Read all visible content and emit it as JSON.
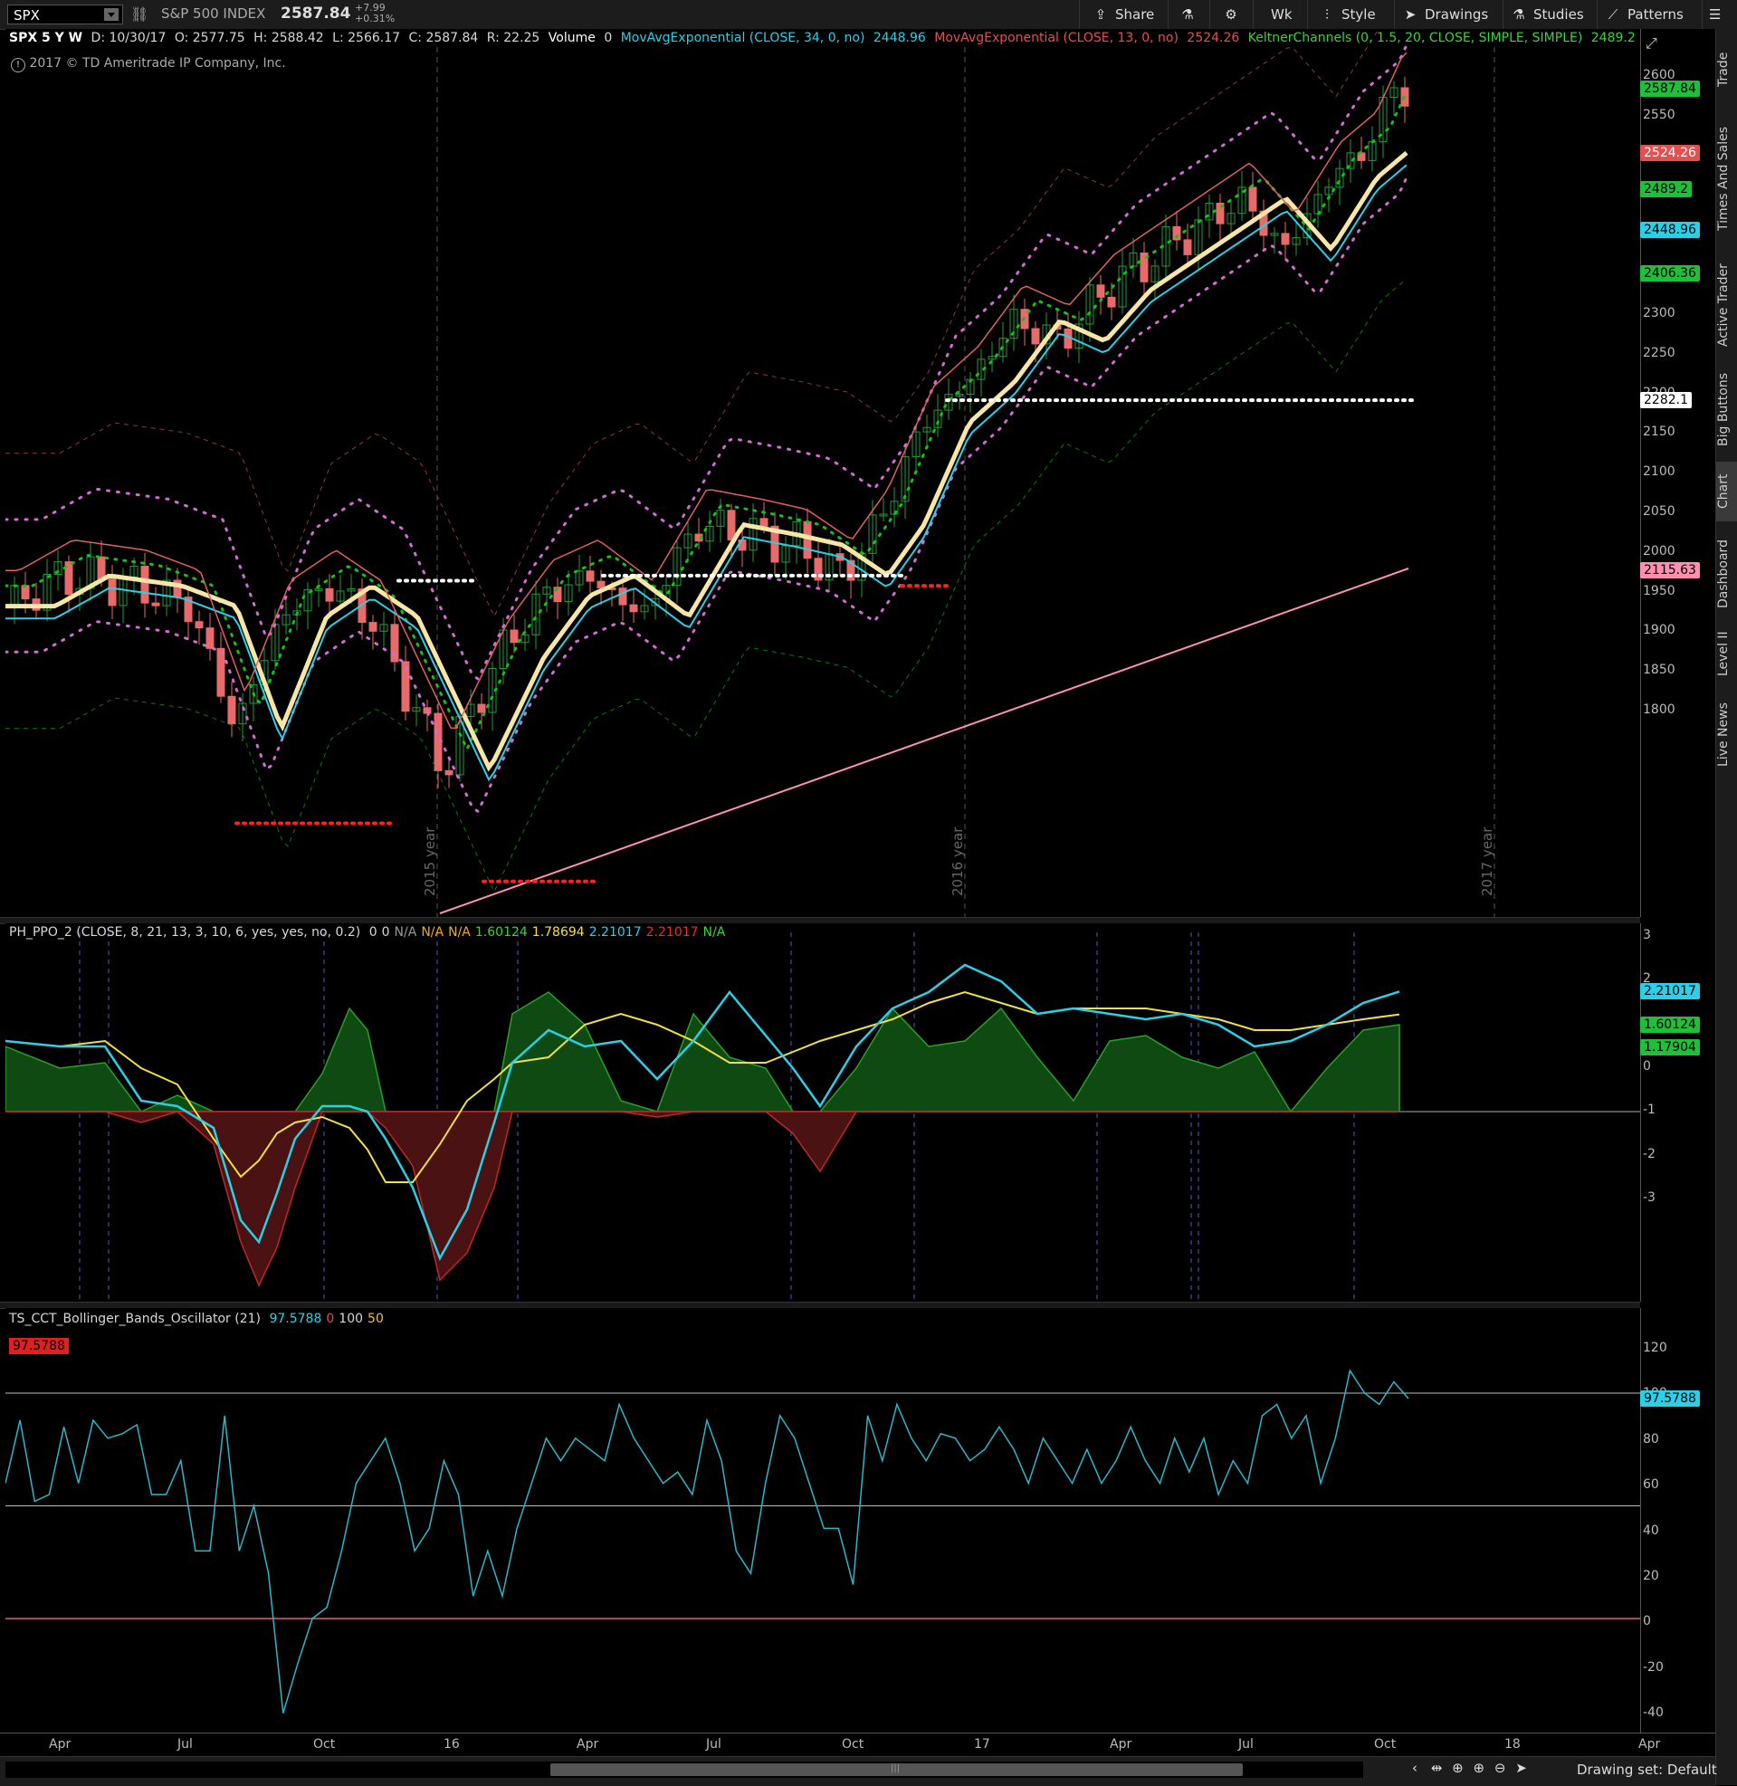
{
  "toolbar": {
    "symbol": "SPX",
    "description": "S&P 500 INDEX",
    "last": "2587.84",
    "change": "+7.99",
    "change_pct": "+0.31%",
    "share": "Share",
    "timeframe": "Wk",
    "style": "Style",
    "drawings": "Drawings",
    "studies": "Studies",
    "patterns": "Patterns"
  },
  "rail": [
    "Trade",
    "Times And Sales",
    "Active Trader",
    "Big Buttons",
    "Chart",
    "Dashboard",
    "Level II",
    "Live News"
  ],
  "price_panel": {
    "header": {
      "title": "SPX 5 Y W",
      "ohlc": [
        "D: 10/30/17",
        "O: 2577.75",
        "H: 2588.42",
        "L: 2566.17",
        "C: 2587.84",
        "R: 22.25"
      ],
      "volume_label": "Volume",
      "volume_val": "0",
      "ema34": "MovAvgExponential (CLOSE, 34, 0, no)",
      "ema34_val": "2448.96",
      "ema13": "MovAvgExponential (CLOSE, 13, 0, no)",
      "ema13_val": "2524.26",
      "keltner": "KeltnerChannels (0, 1.5, 20, CLOSE, SIMPLE, SIMPLE)",
      "keltner_val": "2489.2"
    },
    "copyright": "2017 © TD Ameritrade IP Company, Inc.",
    "ticks": [
      "2600",
      "2550",
      "2500",
      "2450",
      "2400",
      "2350",
      "2300",
      "2250",
      "2200",
      "2150",
      "2100",
      "2050",
      "2000",
      "1950",
      "1900",
      "1850",
      "1800"
    ],
    "tags": [
      {
        "v": "2587.84",
        "bg": "#1fbf3a",
        "fg": "#000"
      },
      {
        "v": "2524.26",
        "bg": "#e25050",
        "fg": "#fff"
      },
      {
        "v": "2489.2",
        "bg": "#1fbf3a",
        "fg": "#000"
      },
      {
        "v": "2448.96",
        "bg": "#2ad0e8",
        "fg": "#000"
      },
      {
        "v": "2406.36",
        "bg": "#1fbf3a",
        "fg": "#000"
      },
      {
        "v": "2282.1",
        "bg": "#ffffff",
        "fg": "#000"
      },
      {
        "v": "2115.63",
        "bg": "#ff8fb0",
        "fg": "#000"
      }
    ],
    "year_labels": [
      "2015 year",
      "2016 year",
      "2017 year"
    ]
  },
  "ppo_panel": {
    "header": {
      "name": "PH_PPO_2 (CLOSE, 8, 21, 13, 3, 10, 6, yes, yes, no, 0.2)",
      "vals": [
        {
          "v": "0",
          "c": "#d7d7d7"
        },
        {
          "v": "0",
          "c": "#d7d7d7"
        },
        {
          "v": "N/A",
          "c": "#999"
        },
        {
          "v": "N/A",
          "c": "#f5a623"
        },
        {
          "v": "N/A",
          "c": "#f5a623"
        },
        {
          "v": "1.60124",
          "c": "#3cd23c"
        },
        {
          "v": "1.78694",
          "c": "#f0e040"
        },
        {
          "v": "2.21017",
          "c": "#2ad0e8"
        },
        {
          "v": "2.21017",
          "c": "#e23030"
        },
        {
          "v": "N/A",
          "c": "#3cd23c"
        }
      ]
    },
    "ticks": [
      "3",
      "2",
      "1",
      "0",
      "-1",
      "-2",
      "-3"
    ],
    "tags": [
      {
        "v": "2.21017",
        "bg": "#2ad0e8",
        "fg": "#000"
      },
      {
        "v": "1.60124",
        "bg": "#1fbf3a",
        "fg": "#000"
      },
      {
        "v": "1.17904",
        "bg": "#1fbf3a",
        "fg": "#000"
      }
    ]
  },
  "osc_panel": {
    "header": {
      "name": "TS_CCT_Bollinger_Bands_Oscillator (21)",
      "vals": [
        {
          "v": "97.5788",
          "c": "#2ad0e8"
        },
        {
          "v": "0",
          "c": "#e25050"
        },
        {
          "v": "100",
          "c": "#d7d7d7"
        },
        {
          "v": "50",
          "c": "#f0c040"
        }
      ]
    },
    "corner_tag": "97.5788",
    "ticks": [
      "120",
      "100",
      "80",
      "60",
      "40",
      "20",
      "0",
      "-20",
      "-40"
    ],
    "tag": "97.5788"
  },
  "time_axis": [
    "Apr",
    "Jul",
    "Oct",
    "16",
    "Apr",
    "Jul",
    "Oct",
    "17",
    "Apr",
    "Jul",
    "Oct",
    "18",
    "Apr"
  ],
  "bottom": {
    "drawing_set": "Drawing set: Default"
  },
  "colors": {
    "bull": "#1f9e3a",
    "bear": "#e86a6a",
    "ema34": "#f7e6a6",
    "ema13": "#e06060",
    "keltner_mid": "#16c016",
    "keltner_band": "#d36bd3",
    "sma_long": "#ff8fb0",
    "ppo_fast": "#2ad0e8",
    "ppo_slow": "#f0e040",
    "osc": "#2ab8c8"
  },
  "chart_data": {
    "type": "candlestick",
    "x_range": [
      "2015-02",
      "2017-10"
    ],
    "price_ylim": [
      1790,
      2610
    ],
    "price_series": [
      {
        "name": "SPX",
        "x": [
          "2015-02",
          "2015-04",
          "2015-06",
          "2015-08",
          "2015-09",
          "2015-11",
          "2016-01",
          "2016-02",
          "2016-04",
          "2016-06",
          "2016-08",
          "2016-11",
          "2017-01",
          "2017-03",
          "2017-05",
          "2017-07",
          "2017-08",
          "2017-10"
        ],
        "close": [
          2100,
          2110,
          2090,
          2035,
          1920,
          2090,
          1940,
          1920,
          2090,
          2080,
          2170,
          2200,
          2280,
          2370,
          2390,
          2470,
          2440,
          2588
        ]
      }
    ],
    "ppo_ylim": [
      -3.5,
      3.1
    ],
    "osc_ylim": [
      -45,
      125
    ]
  }
}
